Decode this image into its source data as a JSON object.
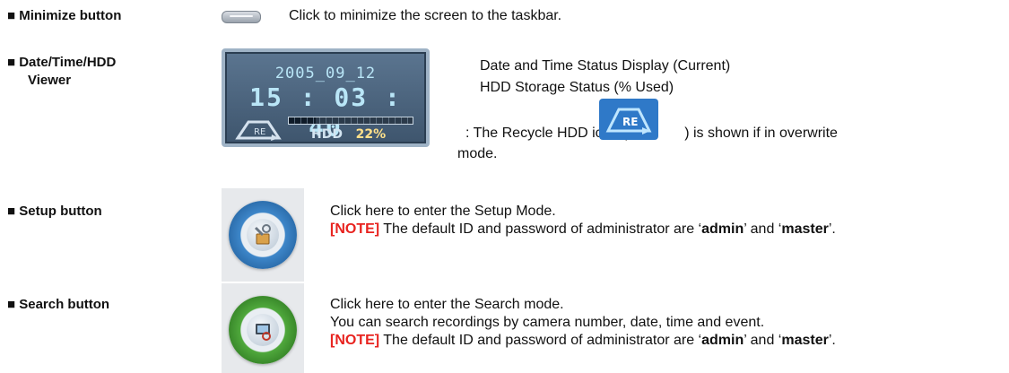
{
  "rows": {
    "minimize": {
      "label": "■ Minimize button",
      "desc": "Click to minimize the screen to the taskbar."
    },
    "viewer": {
      "label_line1": "■ Date/Time/HDD",
      "label_line2": "Viewer",
      "desc_line1": "Date and Time Status Display (Current)",
      "desc_line2": "HDD Storage Status (% Used)",
      "recycle_prefix": ": The Recycle HDD icon (",
      "recycle_suffix": ") is shown if in overwrite",
      "recycle_line2": "mode.",
      "panel": {
        "date": "2005_09_12",
        "time": "15 : 03 : 40",
        "hdd_label": "HDD",
        "hdd_percent": "22",
        "hdd_percent_sign": "%",
        "hdd_used_fraction": 0.22,
        "recycle_badge": "RE"
      }
    },
    "setup": {
      "label": "■ Setup button",
      "desc_line1": "Click here to enter the Setup Mode.",
      "note_tag": "[NOTE]",
      "note_a": " The default ID and password of administrator are ‘",
      "note_id": "admin",
      "note_b": "’ and ‘",
      "note_pw": "master",
      "note_c": "’."
    },
    "search": {
      "label": "■ Search button",
      "desc_line1": "Click here to enter the Search mode.",
      "desc_line2": "You can search recordings by camera number, date, time and event.",
      "note_tag": "[NOTE]",
      "note_a": " The default ID and password of administrator are ‘",
      "note_id": "admin",
      "note_b": "’ and ‘",
      "note_pw": "master",
      "note_c": "’."
    }
  },
  "colors": {
    "note": "#e8231f",
    "setup_ring": "#3d86c9",
    "search_ring": "#4fa83c"
  },
  "icons": {
    "minimize": "minimize-pill-icon",
    "recycle": "recycle-hdd-icon",
    "setup": "setup-tools-icon",
    "search": "search-camera-icon"
  }
}
